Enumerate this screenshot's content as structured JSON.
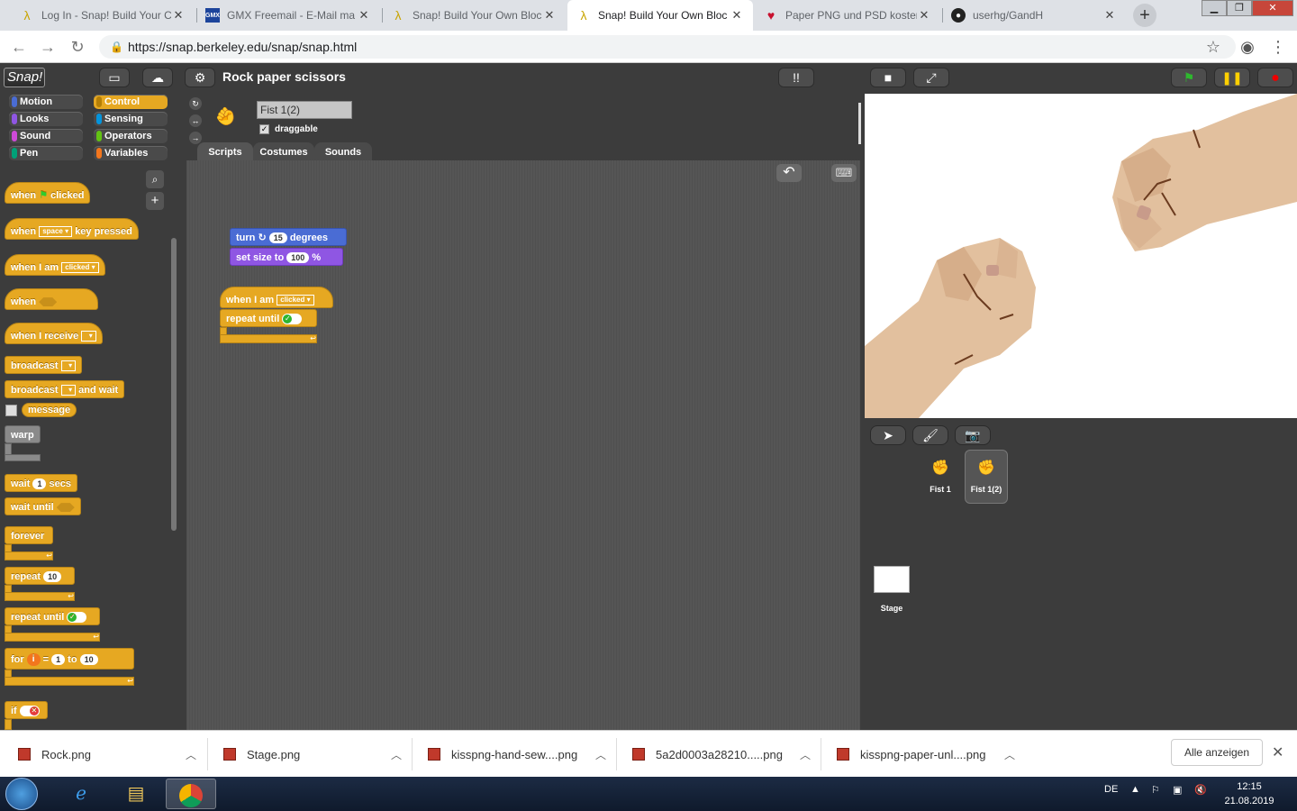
{
  "browser": {
    "tabs": [
      {
        "label": "Log In - Snap! Build Your C",
        "icon": "lambda-icon"
      },
      {
        "label": "GMX Freemail - E-Mail ma",
        "icon": "gmx-icon"
      },
      {
        "label": "Snap! Build Your Own Bloc",
        "icon": "lambda-icon"
      },
      {
        "label": "Snap! Build Your Own Bloc",
        "icon": "lambda-icon"
      },
      {
        "label": "Paper PNG und PSD koster",
        "icon": "heart-icon"
      },
      {
        "label": "userhg/GandH",
        "icon": "github-icon"
      }
    ],
    "url": "https://snap.berkeley.edu/snap/snap.html"
  },
  "snap": {
    "logo": "Snap!",
    "project_title": "Rock paper scissors",
    "categories": [
      {
        "label": "Motion",
        "color": "#4a6cd4"
      },
      {
        "label": "Control",
        "color": "#e6a822"
      },
      {
        "label": "Looks",
        "color": "#8f56e3"
      },
      {
        "label": "Sensing",
        "color": "#0494dc"
      },
      {
        "label": "Sound",
        "color": "#cf4ad9"
      },
      {
        "label": "Operators",
        "color": "#62c213"
      },
      {
        "label": "Pen",
        "color": "#00a178"
      },
      {
        "label": "Variables",
        "color": "#f3761d"
      }
    ],
    "palette": {
      "when": "when",
      "clicked": "clicked",
      "space": "space",
      "key_pressed": "key pressed",
      "when_i_am": "when I am",
      "clicked_opt": "clicked",
      "when_i_receive": "when I receive",
      "broadcast": "broadcast",
      "and_wait": "and wait",
      "message": "message",
      "warp": "warp",
      "wait": "wait",
      "wait_val": "1",
      "secs": "secs",
      "wait_until": "wait until",
      "forever": "forever",
      "repeat": "repeat",
      "repeat_val": "10",
      "repeat_until": "repeat until",
      "for": "for",
      "for_var": "i",
      "for_eq": "=",
      "for_from": "1",
      "to": "to",
      "for_to": "10",
      "if": "if"
    },
    "sprite": {
      "name": "Fist 1(2)",
      "draggable_label": "draggable",
      "draggable_checked": true
    },
    "editor_tabs": [
      "Scripts",
      "Costumes",
      "Sounds"
    ],
    "script": {
      "turn": "turn",
      "turn_val": "15",
      "degrees": "degrees",
      "set_size_to": "set size to",
      "size_val": "100",
      "percent": "%",
      "when_i_am": "when I am",
      "clicked_opt": "clicked",
      "repeat_until": "repeat until"
    },
    "sprites": [
      {
        "name": "Fist 1",
        "selected": false
      },
      {
        "name": "Fist 1(2)",
        "selected": true
      }
    ],
    "stage_label": "Stage"
  },
  "downloads": {
    "items": [
      "Rock.png",
      "Stage.png",
      "kisspng-hand-sew....png",
      "5a2d0003a28210.....png",
      "kisspng-paper-unl....png"
    ],
    "show_all": "Alle anzeigen"
  },
  "taskbar": {
    "lang": "DE",
    "time": "12:15",
    "date": "21.08.2019"
  }
}
